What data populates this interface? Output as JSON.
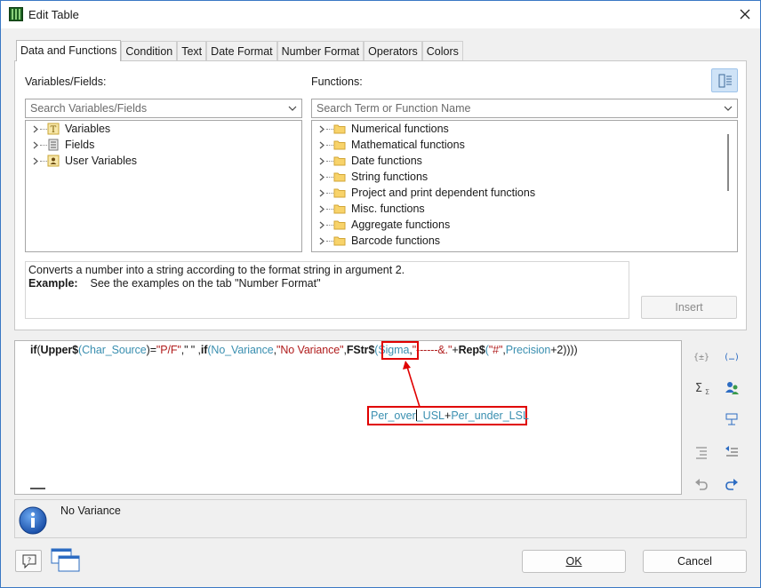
{
  "window": {
    "title": "Edit Table"
  },
  "tabs": [
    {
      "label": "Data and Functions",
      "active": true
    },
    {
      "label": "Condition"
    },
    {
      "label": "Text"
    },
    {
      "label": "Date Format"
    },
    {
      "label": "Number Format"
    },
    {
      "label": "Operators"
    },
    {
      "label": "Colors"
    }
  ],
  "variables": {
    "label": "Variables/Fields:",
    "search_placeholder": "Search Variables/Fields",
    "items": [
      {
        "label": "Variables",
        "icon": "variable-icon"
      },
      {
        "label": "Fields",
        "icon": "field-icon"
      },
      {
        "label": "User Variables",
        "icon": "user-variable-icon"
      }
    ]
  },
  "functions": {
    "label": "Functions:",
    "search_placeholder": "Search Term or Function Name",
    "items": [
      {
        "label": "Numerical functions"
      },
      {
        "label": "Mathematical functions"
      },
      {
        "label": "Date functions"
      },
      {
        "label": "String functions"
      },
      {
        "label": "Project and print dependent functions"
      },
      {
        "label": "Misc. functions"
      },
      {
        "label": "Aggregate functions"
      },
      {
        "label": "Barcode functions"
      }
    ]
  },
  "description": {
    "line1": "Converts a number into a string according to the format string in argument 2.",
    "example_label": "Example:",
    "example_text": "See the examples on the tab \"Number Format\""
  },
  "insert_label": "Insert",
  "expression": {
    "tokens": [
      {
        "t": "if",
        "c": "kw"
      },
      {
        "t": "(",
        "c": "op"
      },
      {
        "t": "Upper$",
        "c": "kw"
      },
      {
        "t": "(",
        "c": "var"
      },
      {
        "t": "Char_Source",
        "c": "var"
      },
      {
        "t": ")=",
        "c": "op"
      },
      {
        "t": "\"P/F\"",
        "c": "str"
      },
      {
        "t": ",\" \" ,",
        "c": "op"
      },
      {
        "t": "if",
        "c": "kw"
      },
      {
        "t": "(",
        "c": "var"
      },
      {
        "t": "No_Variance",
        "c": "var"
      },
      {
        "t": ",",
        "c": "op"
      },
      {
        "t": "\"No Variance\"",
        "c": "str"
      },
      {
        "t": ",",
        "c": "op"
      },
      {
        "t": "FStr$",
        "c": "kw"
      },
      {
        "t": "(",
        "c": "var"
      },
      {
        "t": "Sigma",
        "c": "var"
      },
      {
        "t": ",",
        "c": "op"
      },
      {
        "t": "\"------&.\"",
        "c": "str"
      },
      {
        "t": "+",
        "c": "op"
      },
      {
        "t": "Rep$",
        "c": "kw"
      },
      {
        "t": "(",
        "c": "var"
      },
      {
        "t": "\"#\"",
        "c": "str"
      },
      {
        "t": ",",
        "c": "op"
      },
      {
        "t": "Precision",
        "c": "var"
      },
      {
        "t": "+2))))",
        "c": "op"
      }
    ],
    "popup": {
      "part1": "Per_over",
      "part2": "_USL",
      "plus": "+",
      "part3": "Per_under_LSL"
    }
  },
  "info": {
    "text": "No Variance"
  },
  "buttons": {
    "ok": "OK",
    "cancel": "Cancel"
  }
}
